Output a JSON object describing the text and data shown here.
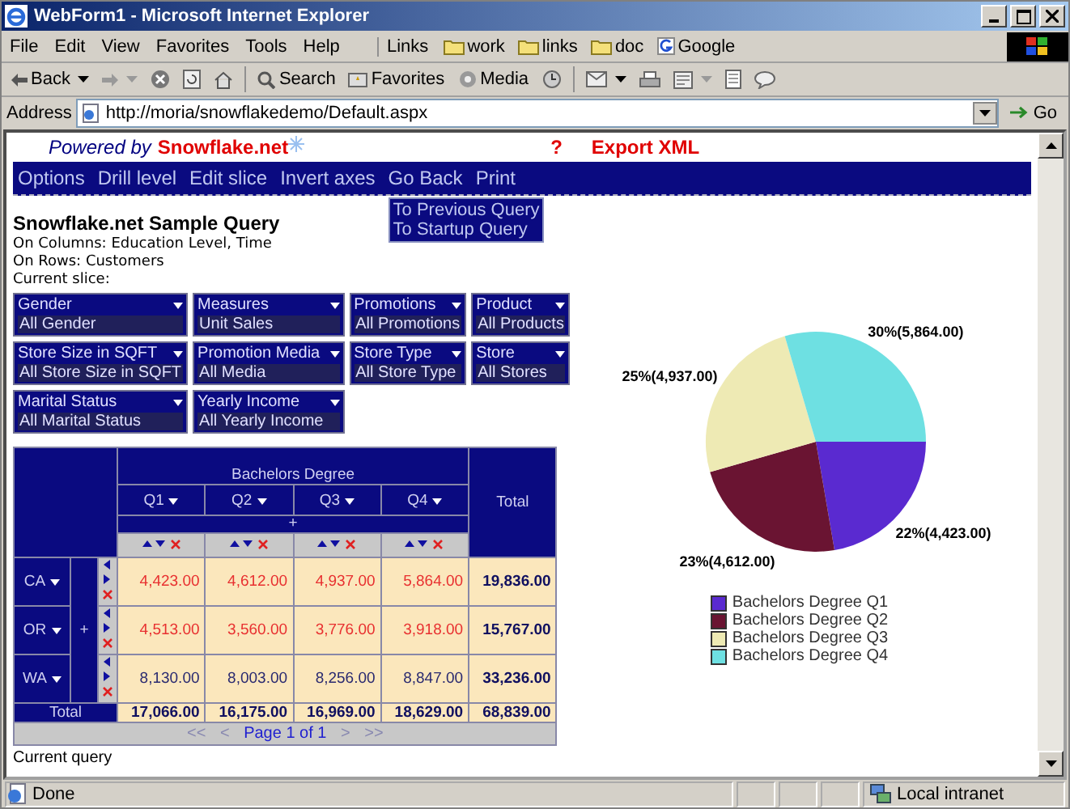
{
  "window": {
    "title": "WebForm1 - Microsoft Internet Explorer"
  },
  "menu_bar": [
    "File",
    "Edit",
    "View",
    "Favorites",
    "Tools",
    "Help"
  ],
  "links_bar": {
    "label": "Links",
    "items": [
      "work",
      "links",
      "doc",
      "Google"
    ]
  },
  "toolbar": [
    "Back",
    "Search",
    "Favorites",
    "Media"
  ],
  "address_bar": {
    "label": "Address",
    "value": "http://moria/snowflakedemo/Default.aspx",
    "go": "Go"
  },
  "page": {
    "powered_by": "Powered by",
    "brand": "Snowflake.net",
    "help": "?",
    "export": "Export XML",
    "nav": [
      "Options",
      "Drill level",
      "Edit slice",
      "Invert axes",
      "Go Back",
      "Print"
    ],
    "go_back_menu": [
      "To Previous Query",
      "To Startup Query"
    ],
    "title": "Snowflake.net Sample Query",
    "lines": [
      "On Columns: Education Level, Time",
      "On Rows: Customers",
      "Current slice:"
    ],
    "slicers": [
      {
        "dimension": "Gender",
        "member": "All Gender"
      },
      {
        "dimension": "Measures",
        "member": "Unit Sales"
      },
      {
        "dimension": "Promotions",
        "member": "All Promotions"
      },
      {
        "dimension": "Product",
        "member": "All Products"
      },
      {
        "dimension": "Store Size in SQFT",
        "member": "All Store Size in SQFT"
      },
      {
        "dimension": "Promotion Media",
        "member": "All Media"
      },
      {
        "dimension": "Store Type",
        "member": "All Store Type"
      },
      {
        "dimension": "Store",
        "member": "All Stores"
      },
      {
        "dimension": "Marital Status",
        "member": "All Marital Status"
      },
      {
        "dimension": "Yearly Income",
        "member": "All Yearly Income"
      }
    ],
    "pivot": {
      "group": "Bachelors Degree",
      "columns": [
        "Q1",
        "Q2",
        "Q3",
        "Q4"
      ],
      "total_header": "Total",
      "expand": "+",
      "row_expand": "+",
      "rows": [
        {
          "label": "CA",
          "highlight": true,
          "cells": [
            "4,423.00",
            "4,612.00",
            "4,937.00",
            "5,864.00"
          ],
          "total": "19,836.00"
        },
        {
          "label": "OR",
          "highlight": true,
          "cells": [
            "4,513.00",
            "3,560.00",
            "3,776.00",
            "3,918.00"
          ],
          "total": "15,767.00"
        },
        {
          "label": "WA",
          "highlight": false,
          "cells": [
            "8,130.00",
            "8,003.00",
            "8,256.00",
            "8,847.00"
          ],
          "total": "33,236.00"
        }
      ],
      "totals": {
        "label": "Total",
        "cells": [
          "17,066.00",
          "16,175.00",
          "16,969.00",
          "18,629.00"
        ],
        "total": "68,839.00"
      },
      "pager": {
        "first": "<<",
        "prev": "<",
        "text": "Page 1 of 1",
        "next": ">",
        "last": ">>"
      }
    },
    "chart_data": {
      "type": "pie",
      "categories": [
        "Bachelors Degree Q1",
        "Bachelors Degree Q2",
        "Bachelors Degree Q3",
        "Bachelors Degree Q4"
      ],
      "values": [
        4423,
        4612,
        4937,
        5864
      ],
      "colors": [
        "#5a2ad0",
        "#6a1432",
        "#eeeab4",
        "#6ee0e2"
      ],
      "value_labels": [
        "22%(4,423.00)",
        "23%(4,612.00)",
        "25%(4,937.00)",
        "30%(5,864.00)"
      ]
    },
    "footer": "Current query"
  },
  "status_bar": {
    "text": "Done",
    "zone": "Local intranet"
  }
}
